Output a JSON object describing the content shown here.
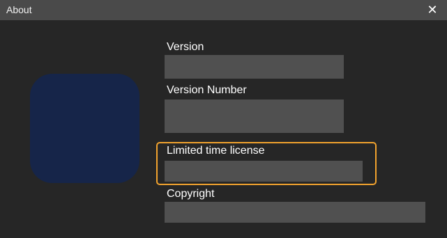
{
  "window": {
    "title": "About",
    "close_icon": "close-icon"
  },
  "app_icon": {
    "icon": "app-logo-icon",
    "color": "#162549"
  },
  "highlight_color": "#f2a32e",
  "fields": {
    "version": {
      "label": "Version",
      "value_lines": [
        ""
      ]
    },
    "version_number": {
      "label": "Version Number",
      "value_lines": [
        "",
        ""
      ]
    },
    "limited_license": {
      "label": "Limited time license",
      "value_lines": [
        ""
      ]
    },
    "copyright": {
      "label": "Copyright",
      "value_lines": [
        ""
      ]
    }
  }
}
